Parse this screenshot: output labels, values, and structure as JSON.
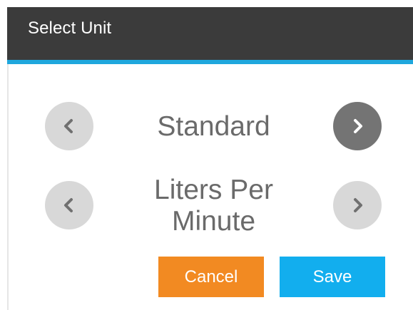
{
  "dialog": {
    "title": "Select Unit",
    "colors": {
      "titlebar": "#3b3b3b",
      "accent": "#1fa7dd",
      "cancel": "#f28a22",
      "save": "#12aeee",
      "value_text": "#6a6a6a"
    }
  },
  "selectors": [
    {
      "value": "Standard",
      "prev_icon": "chevron-left-icon",
      "next_icon": "chevron-right-icon"
    },
    {
      "value_line_1": "Liters Per",
      "value_line_2": "Minute",
      "prev_icon": "chevron-left-icon",
      "next_icon": "chevron-right-icon"
    }
  ],
  "actions": {
    "cancel_label": "Cancel",
    "save_label": "Save"
  }
}
